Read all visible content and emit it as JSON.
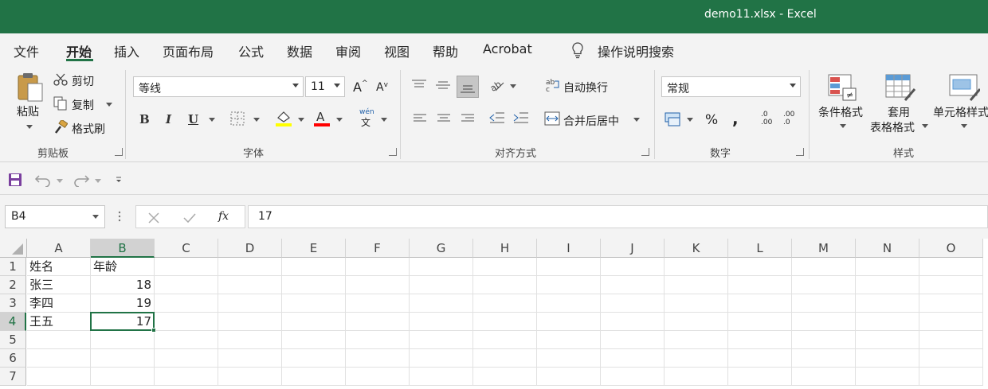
{
  "window": {
    "title": "demo11.xlsx  -  Excel"
  },
  "tabs": [
    "文件",
    "开始",
    "插入",
    "页面布局",
    "公式",
    "数据",
    "审阅",
    "视图",
    "帮助",
    "Acrobat"
  ],
  "active_tab": "开始",
  "tell_me": "操作说明搜索",
  "clipboard": {
    "paste": "粘贴",
    "cut": "剪切",
    "copy": "复制",
    "format_painter": "格式刷",
    "group": "剪贴板"
  },
  "font": {
    "name": "等线",
    "size": "11",
    "bold": "B",
    "italic": "I",
    "underline": "U",
    "group": "字体",
    "phonetic_top": "wén",
    "phonetic_bottom": "文"
  },
  "alignment": {
    "wrap_text": "自动换行",
    "merge_center": "合并后居中",
    "group": "对齐方式"
  },
  "number": {
    "format": "常规",
    "percent": "%",
    "comma": ",",
    "group": "数字",
    "dec_inc": ".0\n.00",
    "dec_dec": ".00\n.0"
  },
  "styles": {
    "conditional": "条件格式",
    "format_table_1": "套用",
    "format_table_2": "表格格式",
    "cell_styles": "单元格样式",
    "group": "样式"
  },
  "formula_bar": {
    "name_box": "B4",
    "fx": "fx",
    "value": "17"
  },
  "sheet": {
    "columns": [
      "A",
      "B",
      "C",
      "D",
      "E",
      "F",
      "G",
      "H",
      "I",
      "J",
      "K",
      "L",
      "M",
      "N",
      "O"
    ],
    "selected_column": "B",
    "rows": [
      "1",
      "2",
      "3",
      "4",
      "5",
      "6",
      "7"
    ],
    "selected_row": "4",
    "cells": {
      "A1": "姓名",
      "B1": "年龄",
      "A2": "张三",
      "B2": "18",
      "A3": "李四",
      "B3": "19",
      "A4": "王五",
      "B4": "17"
    },
    "active_cell": "B4"
  },
  "colors": {
    "accent": "#217346",
    "font_highlight": "#ffff00",
    "font_color": "#ff0000"
  }
}
